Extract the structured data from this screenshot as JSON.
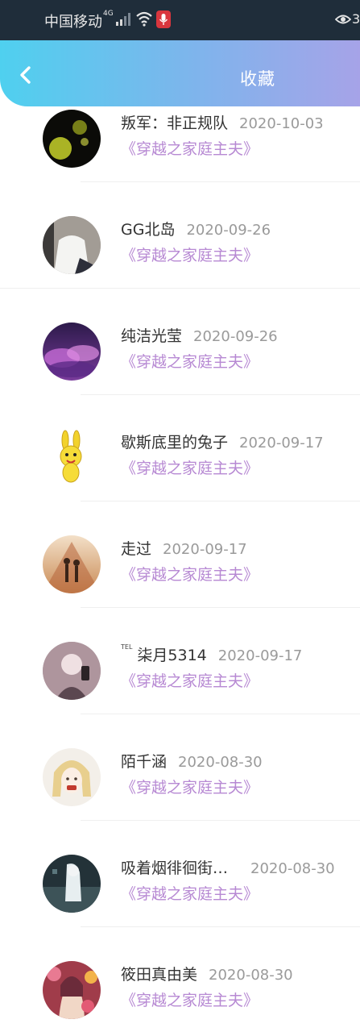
{
  "status_bar": {
    "carrier": "中国移动",
    "network": "4G",
    "right_text": "3",
    "icons": [
      "signal-icon",
      "wifi-icon",
      "mic-icon",
      "eye-icon"
    ]
  },
  "header": {
    "title": "收藏",
    "back_icon": "chevron-left-icon"
  },
  "items": [
    {
      "prefix": "",
      "name": "叛军：非正规队",
      "date": "2020-10-03",
      "book": "《穿越之家庭主夫》",
      "avatar": "dark-yellow"
    },
    {
      "prefix": "",
      "name": "GG北岛",
      "date": "2020-09-26",
      "book": "《穿越之家庭主夫》",
      "avatar": "girl-white"
    },
    {
      "prefix": "",
      "name": "纯洁光莹",
      "date": "2020-09-26",
      "book": "《穿越之家庭主夫》",
      "avatar": "purple-clouds"
    },
    {
      "prefix": "",
      "name": "歇斯底里的兔子",
      "date": "2020-09-17",
      "book": "《穿越之家庭主夫》",
      "avatar": "yellow-bunny"
    },
    {
      "prefix": "",
      "name": "走过",
      "date": "2020-09-17",
      "book": "《穿越之家庭主夫》",
      "avatar": "sunset-couple"
    },
    {
      "prefix": "TEL",
      "name": "柒月5314",
      "date": "2020-09-17",
      "book": "《穿越之家庭主夫》",
      "avatar": "pink-girl"
    },
    {
      "prefix": "",
      "name": "陌千涵",
      "date": "2020-08-30",
      "book": "《穿越之家庭主夫》",
      "avatar": "anime-blonde"
    },
    {
      "prefix": "",
      "name": "吸着烟徘徊街…",
      "date": "2020-08-30",
      "book": "《穿越之家庭主夫》",
      "avatar": "dark-anime"
    },
    {
      "prefix": "",
      "name": "筱田真由美",
      "date": "2020-08-30",
      "book": "《穿越之家庭主夫》",
      "avatar": "colorful-anime"
    }
  ],
  "colors": {
    "header_start": "#4fd0ef",
    "header_end": "#a6a3e8",
    "book_title": "#b789d3",
    "date": "#9a9a9a"
  }
}
